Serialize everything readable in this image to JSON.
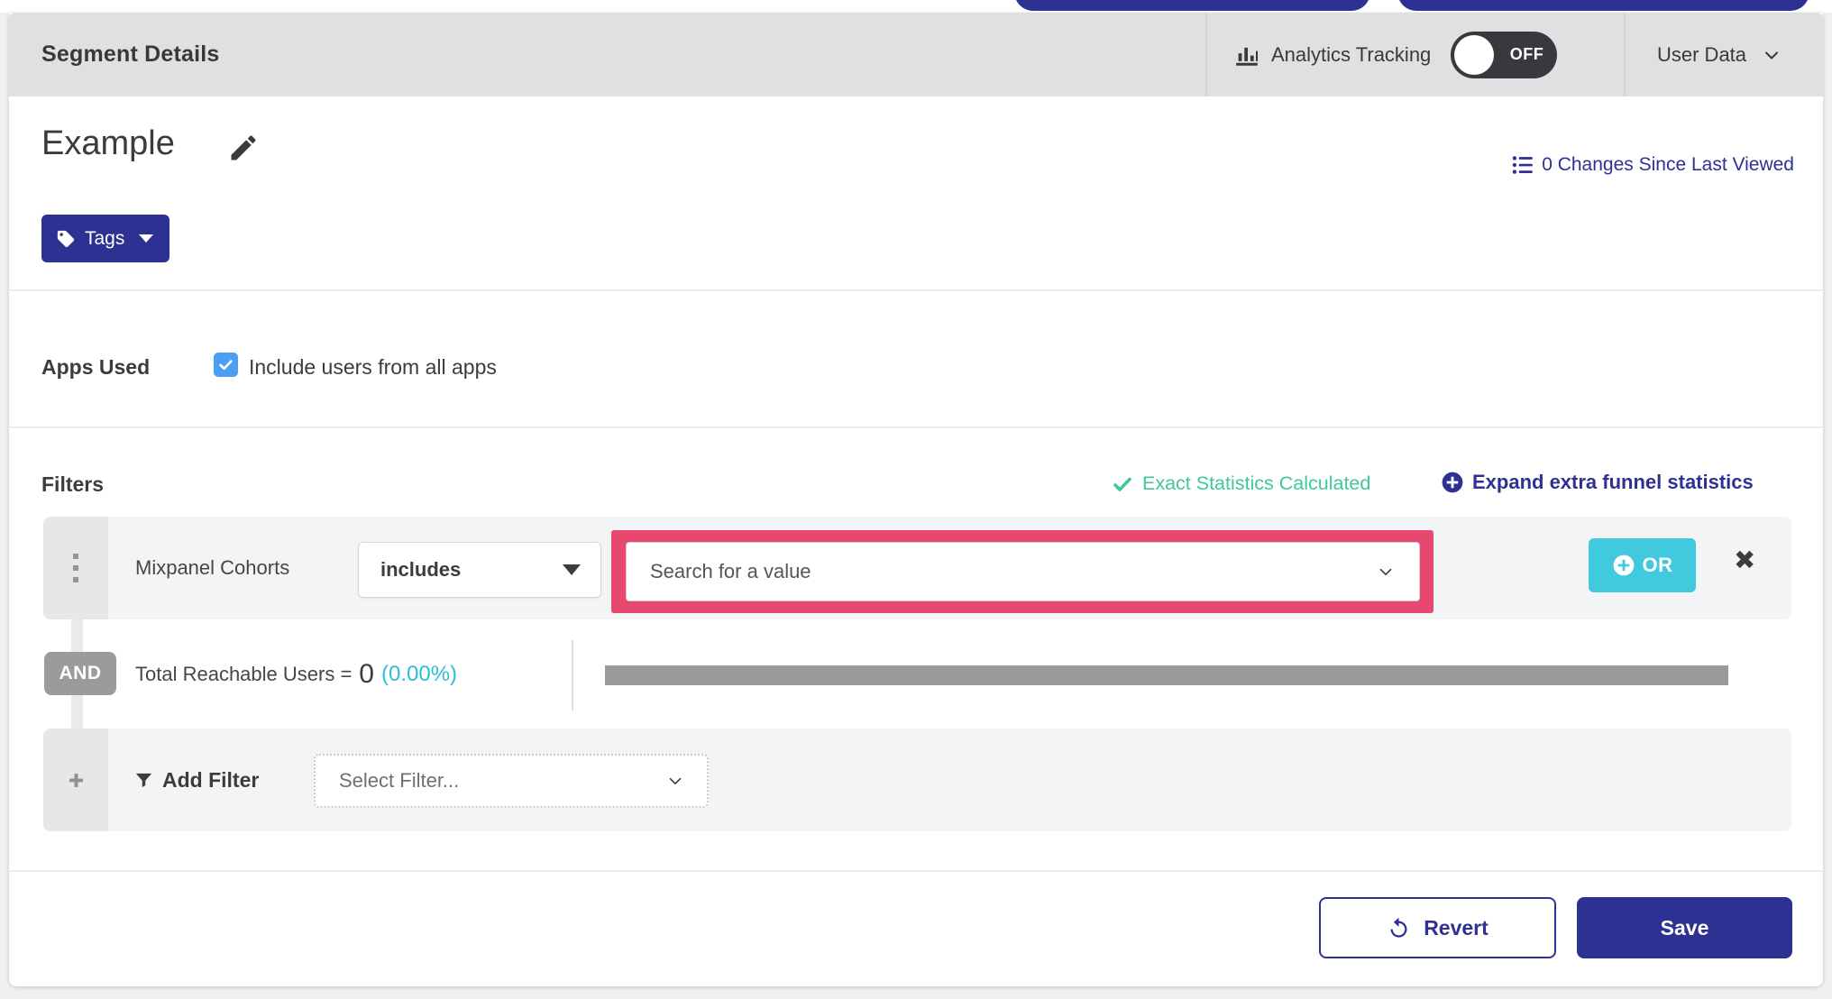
{
  "header": {
    "title": "Segment Details",
    "analytics_tracking": {
      "label": "Analytics Tracking",
      "state": "OFF",
      "enabled": false
    },
    "user_data": {
      "label": "User Data"
    }
  },
  "segment": {
    "name": "Example",
    "changes_link_label": "0 Changes Since Last Viewed",
    "tags_button_label": "Tags"
  },
  "apps_used": {
    "label": "Apps Used",
    "checkbox_label": "Include users from all apps",
    "checked": true
  },
  "filters": {
    "heading": "Filters",
    "exact_statistics_label": "Exact Statistics Calculated",
    "expand_funnel_label": "Expand extra funnel statistics",
    "row": {
      "attribute": "Mixpanel Cohorts",
      "operator": "includes",
      "value_placeholder": "Search for a value",
      "or_button_label": "OR"
    },
    "and_label": "AND",
    "reachable": {
      "label": "Total Reachable Users =",
      "value": "0",
      "percent": "(0.00%)"
    },
    "add_filter": {
      "label": "Add Filter",
      "placeholder": "Select Filter..."
    }
  },
  "footer": {
    "revert_label": "Revert",
    "save_label": "Save"
  },
  "icons": [
    "bar-chart-icon",
    "chevron-down-icon",
    "pencil-icon",
    "changes-list-icon",
    "tag-icon",
    "caret-down-icon",
    "checkmark-icon",
    "plus-circle-icon",
    "drag-handle-icon",
    "close-x-icon",
    "plus-icon",
    "funnel-icon",
    "revert-arrow-icon"
  ],
  "colors": {
    "accent_indigo": "#2d3192",
    "teal_or_button": "#41c9dd",
    "cyan_percent": "#2abfd4",
    "green_success": "#3fc79e",
    "pink_highlight": "#e8486f",
    "checkbox_blue": "#4a9ff5",
    "toggle_dark": "#37393c",
    "header_gray": "#dfe0e2",
    "row_gray": "#f3f4f6"
  }
}
